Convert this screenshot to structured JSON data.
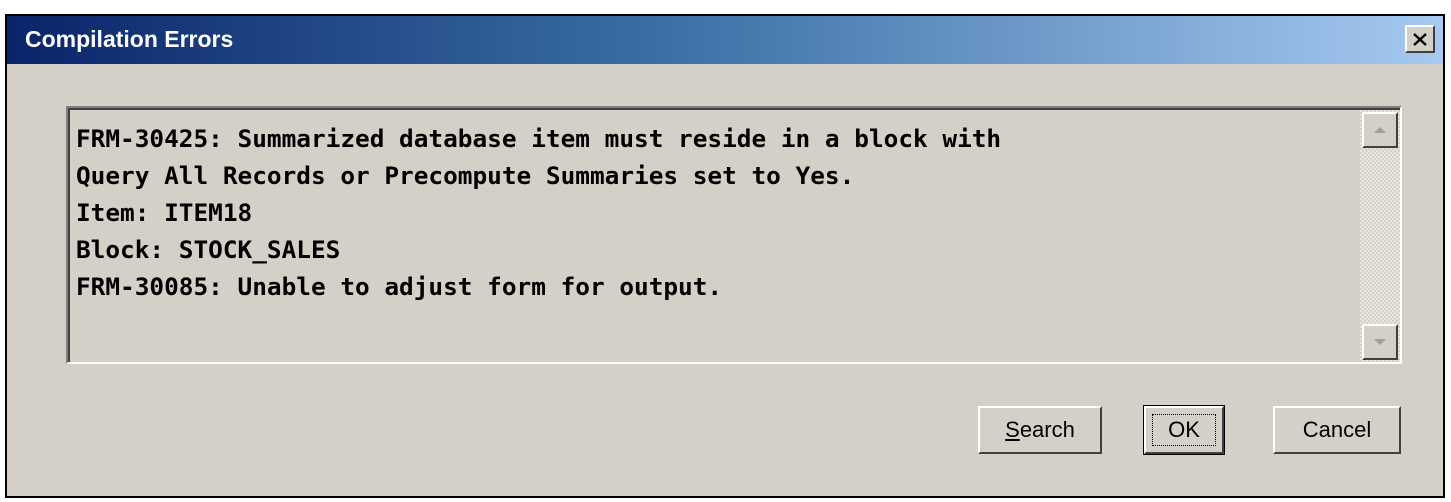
{
  "dialog": {
    "title": "Compilation Errors",
    "close_icon": "close-x-icon"
  },
  "message": {
    "lines": [
      "FRM-30425: Summarized database item must reside in a block with",
      "Query All Records or Precompute Summaries set to Yes.",
      "Item: ITEM18",
      "Block: STOCK_SALES",
      "FRM-30085: Unable to adjust form for output."
    ]
  },
  "scrollbar": {
    "up_icon": "scroll-up-arrow-icon",
    "down_icon": "scroll-down-arrow-icon"
  },
  "buttons": {
    "search_mnemonic": "S",
    "search_rest": "earch",
    "ok": "OK",
    "cancel": "Cancel"
  }
}
